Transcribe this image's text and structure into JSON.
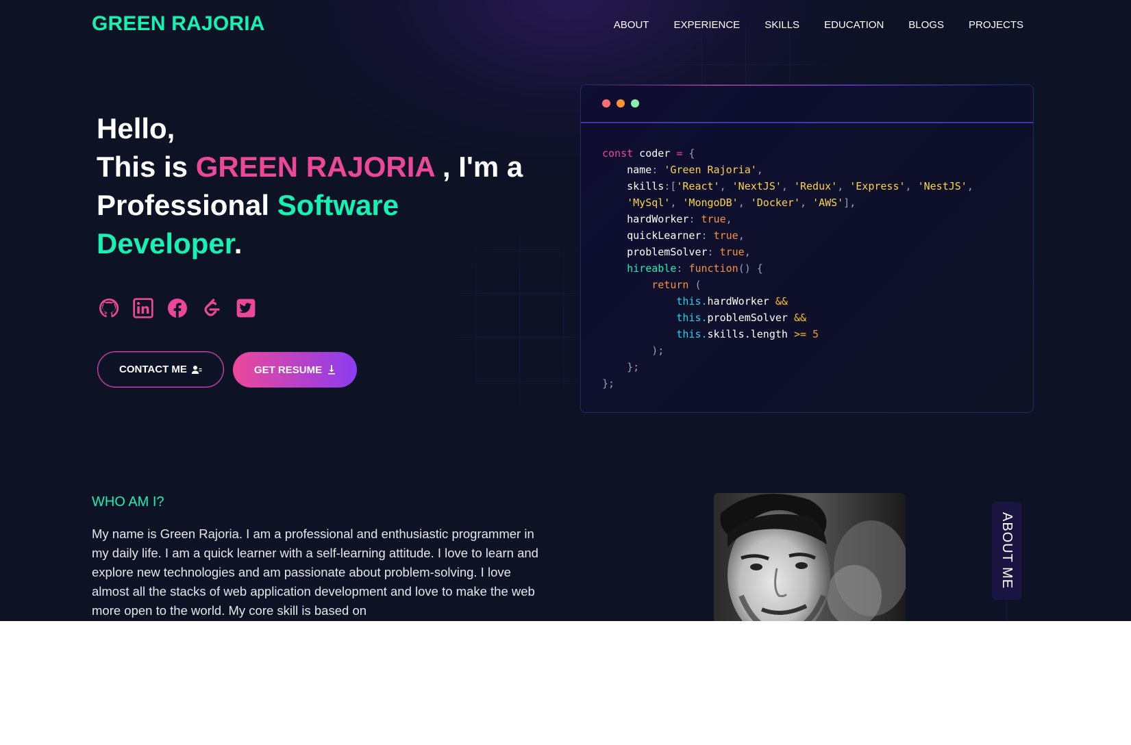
{
  "brand": {
    "name": "GREEN RAJORIA"
  },
  "nav": {
    "items": [
      "ABOUT",
      "EXPERIENCE",
      "SKILLS",
      "EDUCATION",
      "BLOGS",
      "PROJECTS"
    ]
  },
  "hero": {
    "greeting": "Hello,",
    "this_is": "This is ",
    "name": "GREEN RAJORIA",
    "im_a": " , I'm a",
    "professional": "Professional ",
    "role_1": "Software",
    "role_2": "Developer",
    "period": "."
  },
  "socials": [
    "github-icon",
    "linkedin-icon",
    "facebook-icon",
    "leetcode-icon",
    "twitter-icon"
  ],
  "buttons": {
    "contact": "CONTACT ME",
    "resume": "GET RESUME"
  },
  "code_card": {
    "dot_colors": [
      "#f87171",
      "#fb923c",
      "#86efac"
    ],
    "lines": [
      [
        [
          "kw",
          "const"
        ],
        [
          "t",
          " coder "
        ],
        [
          "op",
          "="
        ],
        [
          "punc",
          " {"
        ]
      ],
      [
        [
          "t",
          "    name"
        ],
        [
          "punc",
          ": "
        ],
        [
          "str",
          "'Green Rajoria'"
        ],
        [
          "punc",
          ","
        ]
      ],
      [
        [
          "t",
          "    skills"
        ],
        [
          "punc",
          ":["
        ],
        [
          "str",
          "'React'"
        ],
        [
          "punc",
          ", "
        ],
        [
          "str",
          "'NextJS'"
        ],
        [
          "punc",
          ", "
        ],
        [
          "str",
          "'Redux'"
        ],
        [
          "punc",
          ", "
        ],
        [
          "str",
          "'Express'"
        ],
        [
          "punc",
          ", "
        ],
        [
          "str",
          "'NestJS'"
        ],
        [
          "punc",
          ","
        ]
      ],
      [
        [
          "t",
          "    "
        ],
        [
          "str",
          "'MySql'"
        ],
        [
          "punc",
          ", "
        ],
        [
          "str",
          "'MongoDB'"
        ],
        [
          "punc",
          ", "
        ],
        [
          "str",
          "'Docker'"
        ],
        [
          "punc",
          ", "
        ],
        [
          "str",
          "'AWS'"
        ],
        [
          "punc",
          "],"
        ]
      ],
      [
        [
          "t",
          "    hardWorker"
        ],
        [
          "punc",
          ": "
        ],
        [
          "bool",
          "true"
        ],
        [
          "punc",
          ","
        ]
      ],
      [
        [
          "t",
          "    quickLearner"
        ],
        [
          "punc",
          ": "
        ],
        [
          "bool",
          "true"
        ],
        [
          "punc",
          ","
        ]
      ],
      [
        [
          "t",
          "    problemSolver"
        ],
        [
          "punc",
          ": "
        ],
        [
          "bool",
          "true"
        ],
        [
          "punc",
          ","
        ]
      ],
      [
        [
          "prop",
          "    hireable"
        ],
        [
          "punc",
          ": "
        ],
        [
          "fn",
          "function"
        ],
        [
          "punc",
          "() {"
        ]
      ],
      [
        [
          "t",
          "        "
        ],
        [
          "fn",
          "return"
        ],
        [
          "punc",
          " ("
        ]
      ],
      [
        [
          "t",
          "            "
        ],
        [
          "this",
          "this."
        ],
        [
          "t",
          "hardWorker "
        ],
        [
          "amp",
          "&&"
        ]
      ],
      [
        [
          "t",
          "            "
        ],
        [
          "this",
          "this."
        ],
        [
          "t",
          "problemSolver "
        ],
        [
          "amp",
          "&&"
        ]
      ],
      [
        [
          "t",
          "            "
        ],
        [
          "this",
          "this."
        ],
        [
          "t",
          "skills.length "
        ],
        [
          "amp",
          ">="
        ],
        [
          "num",
          " 5"
        ]
      ],
      [
        [
          "punc",
          "        );"
        ]
      ],
      [
        [
          "punc",
          "    };"
        ]
      ],
      [
        [
          "punc",
          "};"
        ]
      ]
    ]
  },
  "about": {
    "heading": "WHO AM I?",
    "text": "My name is Green Rajoria. I am a professional and enthusiastic programmer in my daily life. I am a quick learner with a self-learning attitude. I love to learn and explore new technologies and am passionate about problem-solving. I love almost all the stacks of web application development and love to make the web more open to the world. My core skill is based on",
    "tab_label": "ABOUT ME"
  }
}
